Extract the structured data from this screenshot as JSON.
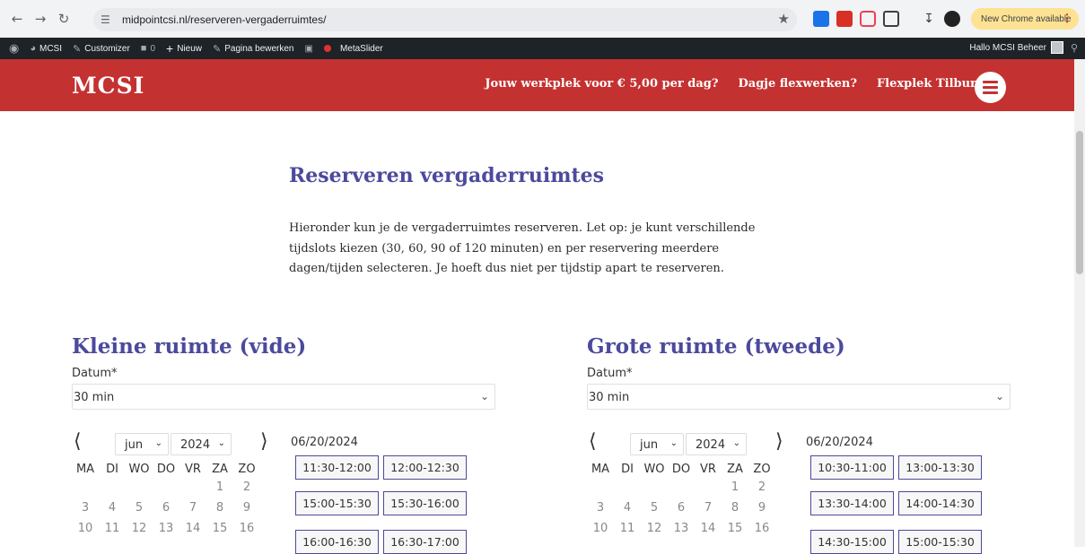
{
  "browser": {
    "url": "midpointcsi.nl/reserveren-vergaderruimtes/",
    "update_label": "New Chrome available"
  },
  "adminbar": {
    "site": "MCSI",
    "customizer": "Customizer",
    "comments_count": "0",
    "new": "Nieuw",
    "edit_page": "Pagina bewerken",
    "metaslider": "MetaSlider",
    "greeting": "Hallo MCSI Beheer"
  },
  "header": {
    "logo": "MCSI",
    "nav": [
      "Jouw werkplek voor € 5,00 per dag?",
      "Dagje flexwerken?",
      "Flexplek Tilburg"
    ],
    "brand_color": "#c43131"
  },
  "page": {
    "title": "Reserveren vergaderruimtes",
    "intro": "Hieronder kun je de vergaderruimtes reserveren. Let op: je kunt verschillende tijdslots kiezen (30, 60, 90 of 120 minuten) en per reservering meerdere dagen/tijden selecteren. Je hoeft dus niet per tijdstip apart te reserveren."
  },
  "rooms": [
    {
      "title": "Kleine ruimte (vide)",
      "date_label": "Datum*",
      "duration": "30 min",
      "month": "jun",
      "year": "2024",
      "selected_date": "06/20/2024",
      "weekdays": [
        "MA",
        "DI",
        "WO",
        "DO",
        "VR",
        "ZA",
        "ZO"
      ],
      "weeks": [
        [
          "",
          "",
          "",
          "",
          "",
          "1",
          "2"
        ],
        [
          "3",
          "4",
          "5",
          "6",
          "7",
          "8",
          "9"
        ],
        [
          "10",
          "11",
          "12",
          "13",
          "14",
          "15",
          "16"
        ]
      ],
      "slots": [
        "11:30-12:00",
        "12:00-12:30",
        "15:00-15:30",
        "15:30-16:00",
        "16:00-16:30",
        "16:30-17:00"
      ]
    },
    {
      "title": "Grote ruimte (tweede)",
      "date_label": "Datum*",
      "duration": "30 min",
      "month": "jun",
      "year": "2024",
      "selected_date": "06/20/2024",
      "weekdays": [
        "MA",
        "DI",
        "WO",
        "DO",
        "VR",
        "ZA",
        "ZO"
      ],
      "weeks": [
        [
          "",
          "",
          "",
          "",
          "",
          "1",
          "2"
        ],
        [
          "3",
          "4",
          "5",
          "6",
          "7",
          "8",
          "9"
        ],
        [
          "10",
          "11",
          "12",
          "13",
          "14",
          "15",
          "16"
        ]
      ],
      "slots": [
        "10:30-11:00",
        "13:00-13:30",
        "13:30-14:00",
        "14:00-14:30",
        "14:30-15:00",
        "15:00-15:30"
      ]
    }
  ]
}
